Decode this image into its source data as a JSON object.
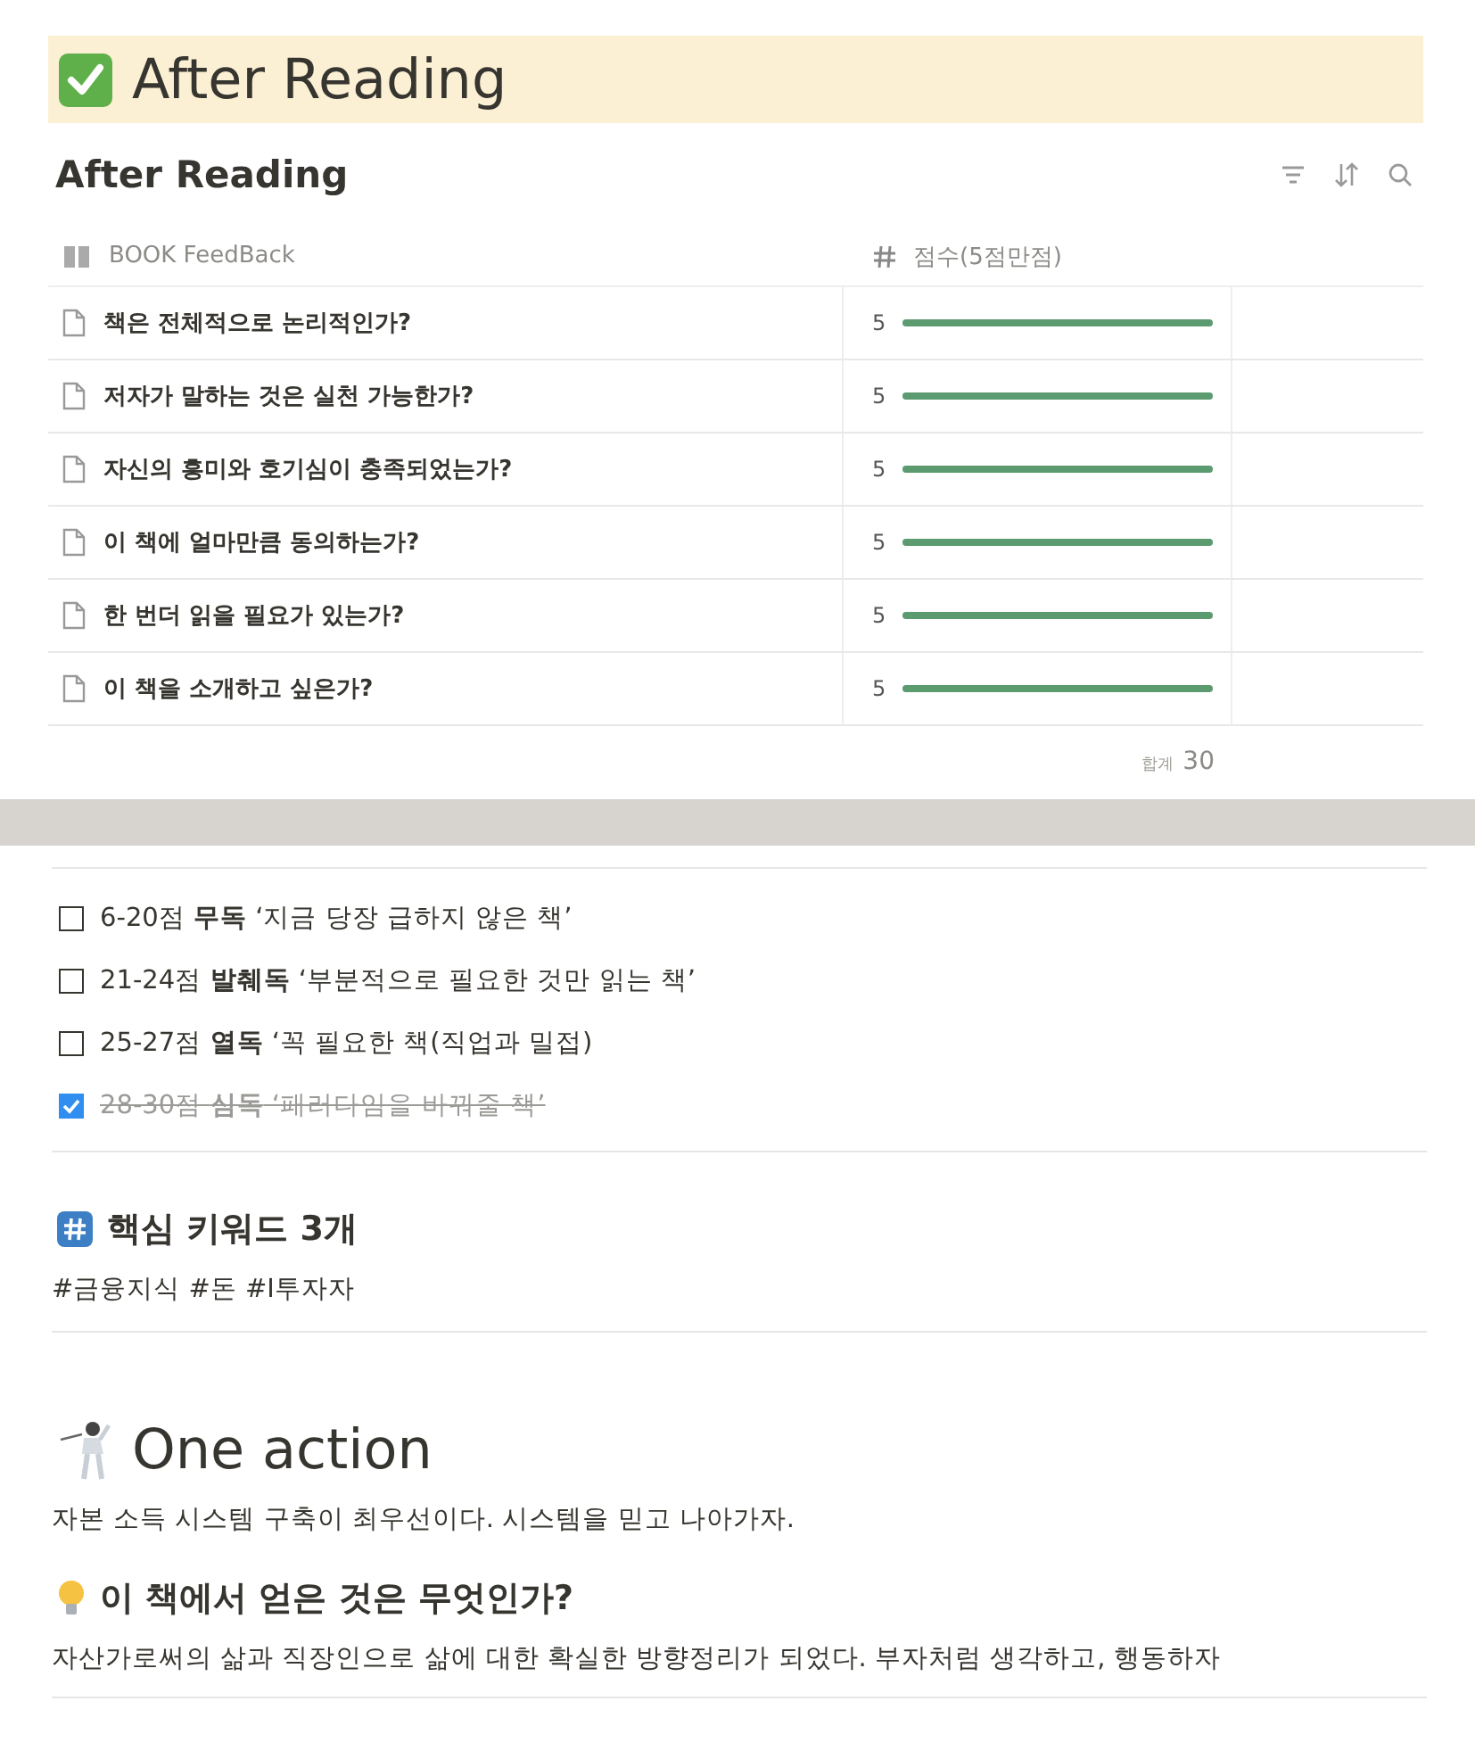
{
  "page_title": "After Reading",
  "database": {
    "title": "After Reading",
    "columns": [
      "BOOK FeedBack",
      "점수(5점만점)"
    ],
    "rows": [
      {
        "question": "책은 전체적으로 논리적인가?",
        "score": "5",
        "level": 1
      },
      {
        "question": "저자가 말하는 것은 실천 가능한가?",
        "score": "5",
        "level": 1
      },
      {
        "question": "자신의 흥미와 호기심이 충족되었는가?",
        "score": "5",
        "level": 1
      },
      {
        "question": "이 책에 얼마만큼 동의하는가?",
        "score": "5",
        "level": 1
      },
      {
        "question": "한 번더 읽을 필요가 있는가?",
        "score": "5",
        "level": 1
      },
      {
        "question": "이 책을 소개하고 싶은가?",
        "score": "5",
        "level": 1
      }
    ],
    "sum_label": "합계",
    "sum_value": "30"
  },
  "checklist": [
    {
      "text": "6-20점 **무독** ‘지금 당장 급하지 않은 책’",
      "checked": false
    },
    {
      "text": "21-24점 **발췌독** ‘부분적으로 필요한 것만 읽는 책’",
      "checked": false
    },
    {
      "text": "25-27점 **열독** ‘꼭 필요한 책(직업과 밀접)",
      "checked": false
    },
    {
      "text": "28-30점 **심독** ‘패러다임을 바꿔줄 책’",
      "checked": true
    }
  ],
  "keywords": {
    "heading": "핵심 키워드 3개",
    "text": "#금융지식 #돈 #I투자자"
  },
  "action": {
    "heading": "One action",
    "text": "자본 소득 시스템 구축이 최우선이다. 시스템을 믿고 나아가자."
  },
  "gained": {
    "heading": "이 책에서 얻은 것은 무엇인가?",
    "text": "자산가로써의 삶과 직장인으로 삶에 대한 확실한 방향정리가 되었다. 부자처럼 생각하고, 행동하자"
  }
}
